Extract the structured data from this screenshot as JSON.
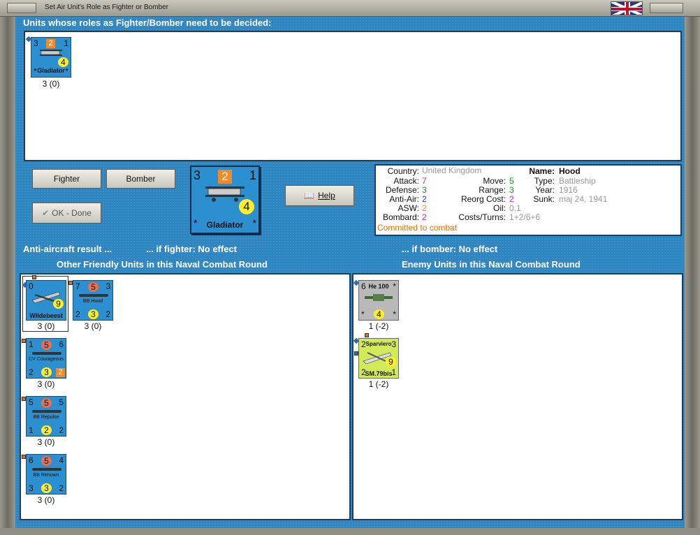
{
  "window": {
    "title": "Set Air Unit's Role as Fighter or Bomber"
  },
  "undecided": {
    "header": "Units whose roles as Fighter/Bomber need to be decided:",
    "units": [
      {
        "tl": "3",
        "top": "2",
        "tr": "1",
        "mid": "4",
        "name": "Gladiator",
        "bl": "*",
        "br": "*",
        "caption": "3 (0)"
      }
    ]
  },
  "buttons": {
    "fighter": "Fighter",
    "bomber": "Bomber",
    "ok": "OK - Done",
    "help": "Help"
  },
  "selected_unit": {
    "tl": "3",
    "top": "2",
    "tr": "1",
    "mid": "4",
    "name": "Gladiator",
    "bl": "*",
    "br": "*"
  },
  "info": {
    "country_label": "Country:",
    "country": "United Kingdom",
    "attack_label": "Attack:",
    "attack": "7",
    "defense_label": "Defense:",
    "defense": "3",
    "antiair_label": "Anti-Air:",
    "antiair": "2",
    "asw_label": "ASW:",
    "asw": "2",
    "bombard_label": "Bombard:",
    "bombard": "2",
    "move_label": "Move:",
    "move": "5",
    "range_label": "Range:",
    "range": "3",
    "reorg_label": "Reorg Cost:",
    "reorg": "2",
    "oil_label": "Oil:",
    "oil": "0,1",
    "costs_label": "Costs/Turns:",
    "costs": "1+2/6+6",
    "name_label": "Name:",
    "name": "Hood",
    "type_label": "Type:",
    "type": "Battleship",
    "year_label": "Year:",
    "year": "1916",
    "sunk_label": "Sunk:",
    "sunk": "maj 24, 1941",
    "status": "Committed to combat",
    "colors": {
      "attack": "#e03030",
      "defense": "#1a9a1a",
      "antiair": "#2040d0",
      "asw": "#f08a2a",
      "bombard": "#c020c0",
      "move": "#1a9a1a",
      "range": "#1a9a1a",
      "reorg": "#c020c0",
      "status": "#e07000"
    }
  },
  "antiaircraft": {
    "label": "Anti-aircraft result ...",
    "fighter": "... if fighter:  No effect",
    "bomber": "... if bomber:  No effect"
  },
  "friendly": {
    "header": "Other Friendly Units in this Naval Combat Round",
    "units": [
      {
        "kind": "air",
        "tl": "0",
        "mid": "9",
        "name": "Wildebeest",
        "caption": "3 (0)"
      },
      {
        "kind": "ship",
        "tl": "7",
        "top": "5",
        "tr": "3",
        "name": "BB Hood",
        "bl": "2",
        "bot": "3",
        "br": "2",
        "caption": "3 (0)"
      },
      {
        "kind": "ship",
        "tl": "1",
        "top": "5",
        "tr": "6",
        "name": "CV Courageous",
        "bl": "2",
        "bot": "3",
        "br": "2",
        "caption": "3 (0)"
      },
      {
        "kind": "ship",
        "tl": "5",
        "top": "5",
        "tr": "5",
        "name": "BB Repulse",
        "bl": "1",
        "bot": "2",
        "br": "2",
        "caption": "3 (0)"
      },
      {
        "kind": "ship",
        "tl": "6",
        "top": "5",
        "tr": "4",
        "name": "BB Renown",
        "bl": "3",
        "bot": "3",
        "br": "2",
        "caption": "3 (0)"
      }
    ]
  },
  "enemy": {
    "header": "Enemy Units in this Naval Combat Round",
    "units": [
      {
        "tl": "6",
        "name": "He 100",
        "tr": "*",
        "bl": "*",
        "bot": "4",
        "br": "*",
        "caption": "1 (-2)"
      },
      {
        "tl": "2",
        "name": "Sparviero",
        "tr": "3",
        "mid": "9",
        "bl": "2",
        "bottom_name": "SM.79bis",
        "br": "1",
        "caption": "1 (-2)"
      }
    ]
  }
}
